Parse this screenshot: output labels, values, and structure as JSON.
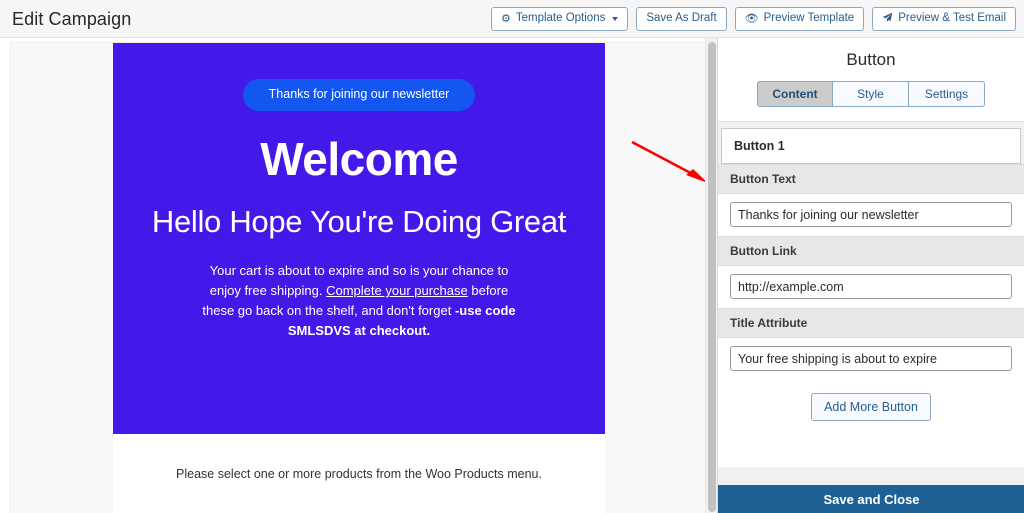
{
  "topbar": {
    "title": "Edit Campaign",
    "buttons": [
      {
        "label": "Template Options",
        "icon": "gear-icon",
        "has_caret": true
      },
      {
        "label": "Save As Draft",
        "icon": "",
        "has_caret": false
      },
      {
        "label": "Preview Template",
        "icon": "eye-icon",
        "has_caret": false
      },
      {
        "label": "Preview & Test Email",
        "icon": "paper-plane-icon",
        "has_caret": false
      }
    ]
  },
  "email": {
    "hero_bg": "#4318e8",
    "badge": {
      "label": "Thanks for joining our newsletter",
      "bg": "#1357f0"
    },
    "heading": "Welcome",
    "subheading": "Hello Hope You're Doing Great",
    "paragraph": {
      "part1": "Your cart is about to expire and so is your chance to enjoy free shipping. ",
      "link": "Complete your purchase",
      "part2": " before these go back on the shelf, and don't forget ",
      "bold": "-use code SMLSDVS at checkout."
    },
    "products_note": "Please select one or more products from the Woo Products menu."
  },
  "panel": {
    "title": "Button",
    "tabs": [
      {
        "label": "Content",
        "active": true
      },
      {
        "label": "Style",
        "active": false
      },
      {
        "label": "Settings",
        "active": false
      }
    ],
    "item_header": "Button 1",
    "fields": [
      {
        "label": "Button Text",
        "value": "Thanks for joining our newsletter"
      },
      {
        "label": "Button Link",
        "value": "http://example.com"
      },
      {
        "label": "Title Attribute",
        "value": "Your free shipping is about to expire"
      }
    ],
    "add_more_label": "Add More Button",
    "save_close_label": "Save and Close",
    "save_close_color": "#1d6094"
  },
  "annotation": {
    "arrow_color": "#ff0000"
  }
}
